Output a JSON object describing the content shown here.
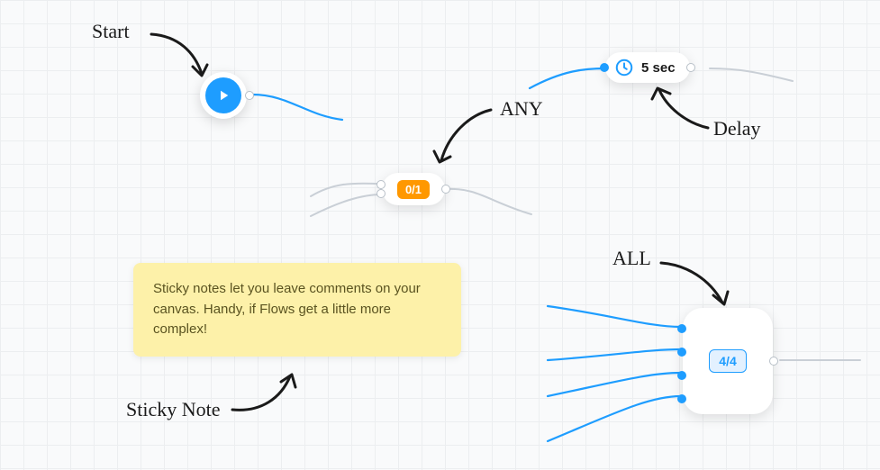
{
  "labels": {
    "start": "Start",
    "any": "ANY",
    "delay": "Delay",
    "all": "ALL",
    "sticky_note": "Sticky Note"
  },
  "nodes": {
    "start": {
      "type": "start"
    },
    "any_gate": {
      "badge": "0/1"
    },
    "delay_node": {
      "value": "5 sec",
      "icon": "clock"
    },
    "all_gate": {
      "badge": "4/4"
    }
  },
  "sticky": {
    "text": "Sticky notes let you leave comments on your canvas. Handy, if Flows get a little more complex!"
  },
  "colors": {
    "accent_blue": "#1e9dff",
    "accent_orange": "#ff9800",
    "sticky_bg": "#fdf1a9"
  }
}
